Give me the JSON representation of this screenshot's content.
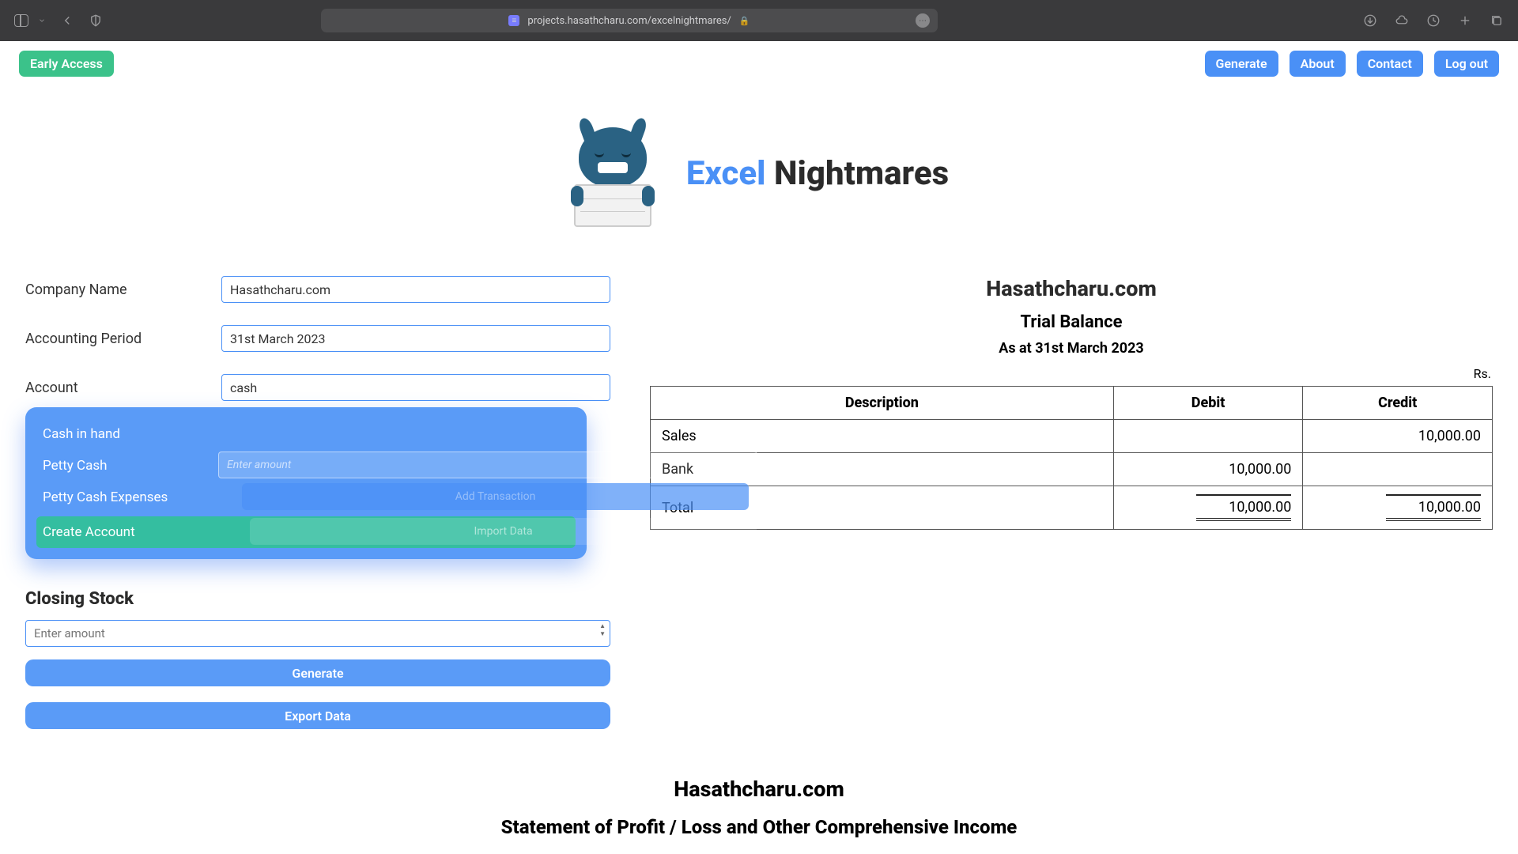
{
  "browser": {
    "url": "projects.hasathcharu.com/excelnightmares/"
  },
  "topbar": {
    "early_access": "Early Access",
    "nav": {
      "generate": "Generate",
      "about": "About",
      "contact": "Contact",
      "logout": "Log out"
    }
  },
  "hero": {
    "word1": "Excel",
    "word2": "Nightmares"
  },
  "form": {
    "company_name_label": "Company Name",
    "company_name_value": "Hasathcharu.com",
    "accounting_period_label": "Accounting Period",
    "accounting_period_value": "31st March 2023",
    "account_label": "Account",
    "account_value": "cash",
    "amount_placeholder": "Enter amount",
    "ghost_add": "Add Transaction",
    "ghost_import": "Import Data",
    "dropdown": {
      "item1": "Cash in hand",
      "item2": "Petty Cash",
      "item3": "Petty Cash Expenses",
      "create": "Create Account"
    },
    "closing_stock_heading": "Closing Stock",
    "closing_stock_placeholder": "Enter amount",
    "generate_btn": "Generate",
    "export_btn": "Export Data"
  },
  "report": {
    "company": "Hasathcharu.com",
    "title": "Trial Balance",
    "as_at": "As at 31st March 2023",
    "currency": "Rs.",
    "headers": {
      "desc": "Description",
      "debit": "Debit",
      "credit": "Credit"
    },
    "rows": {
      "r1": {
        "desc": "Sales",
        "debit": "",
        "credit": "10,000.00"
      },
      "r2": {
        "desc": "Bank",
        "debit": "10,000.00",
        "credit": ""
      }
    },
    "total_label": "Total",
    "total_debit": "10,000.00",
    "total_credit": "10,000.00"
  },
  "second_report": {
    "company": "Hasathcharu.com",
    "title": "Statement of Profit / Loss and Other Comprehensive Income"
  }
}
